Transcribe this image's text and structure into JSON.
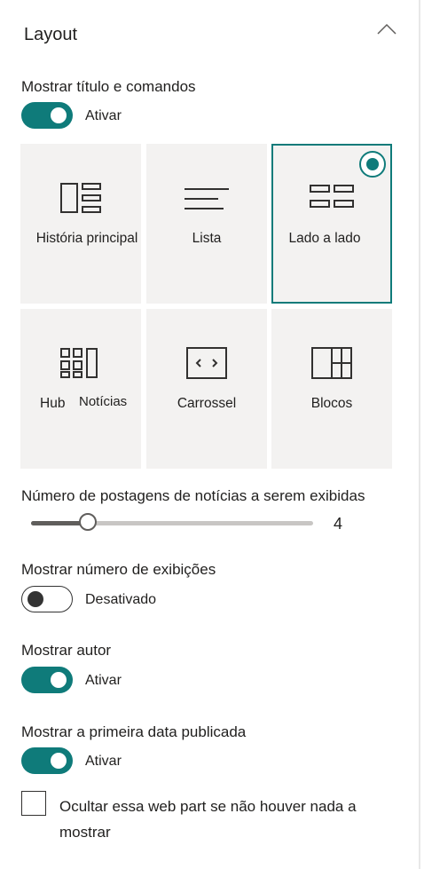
{
  "panel": {
    "title": "Layout"
  },
  "show_title": {
    "label": "Mostrar título e comandos",
    "state": "Ativar",
    "on": true
  },
  "layouts": [
    {
      "label": "História principal",
      "icon": "top-story-icon",
      "selected": false
    },
    {
      "label": "Lista",
      "icon": "list-icon",
      "selected": false
    },
    {
      "label": "Lado a lado",
      "icon": "side-by-side-icon",
      "selected": true
    },
    {
      "label": "Hub",
      "label2": "Notícias",
      "icon": "hub-news-icon",
      "selected": false
    },
    {
      "label": "Carrossel",
      "icon": "carousel-icon",
      "selected": false
    },
    {
      "label": "Blocos",
      "icon": "tiles-icon",
      "selected": false
    }
  ],
  "posts": {
    "label": "Número de postagens de notícias a serem exibidas",
    "value": "4",
    "fraction": 0.2
  },
  "view_count": {
    "label": "Mostrar número de exibições",
    "state": "Desativado",
    "on": false
  },
  "author": {
    "label": "Mostrar autor",
    "state": "Ativar",
    "on": true
  },
  "first_date": {
    "label": "Mostrar a primeira data publicada",
    "state": "Ativar",
    "on": true
  },
  "hide_empty": {
    "line1": "Ocultar essa web part se não houver nada a",
    "line2": "mostrar",
    "checked": false
  },
  "colors": {
    "accent": "#0f7b7a",
    "tile_bg": "#f3f2f1"
  }
}
